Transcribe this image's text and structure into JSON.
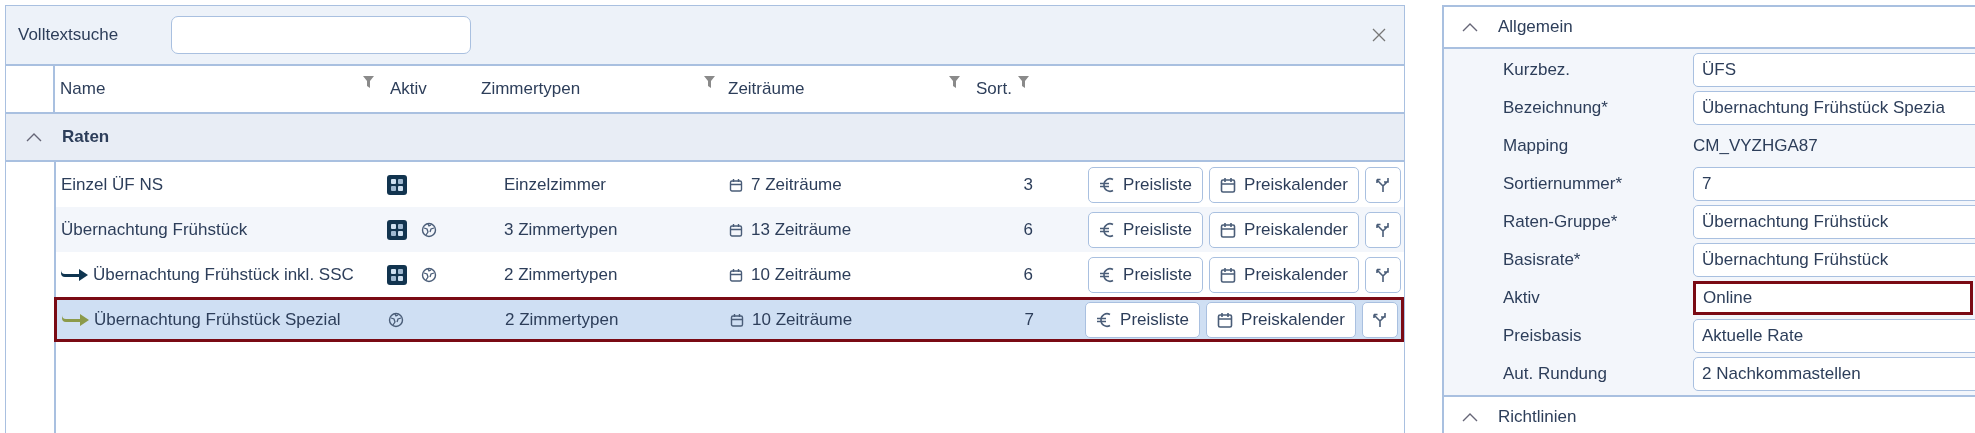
{
  "search": {
    "label": "Volltextsuche"
  },
  "columns": [
    {
      "label": "Name",
      "filterable": true
    },
    {
      "label": "Aktiv",
      "filterable": false
    },
    {
      "label": "Zimmertypen",
      "filterable": true
    },
    {
      "label": "Zeiträume",
      "filterable": true
    },
    {
      "label": "Sort.",
      "filterable": true
    }
  ],
  "group": {
    "label": "Raten",
    "expanded": true
  },
  "rows": [
    {
      "name": "Einzel ÜF NS",
      "online": true,
      "web": false,
      "zimmertypen": "Einzelzimmer",
      "zeitraeume": "7 Zeiträume",
      "sort": "3",
      "selected": false,
      "buttons": [
        "Preisliste",
        "Preiskalender"
      ]
    },
    {
      "name": "Übernachtung Frühstück",
      "online": true,
      "web": true,
      "zimmertypen": "3 Zimmertypen",
      "zeitraeume": "13 Zeiträume",
      "sort": "6",
      "selected": false,
      "buttons": [
        "Preisliste",
        "Preiskalender"
      ]
    },
    {
      "name": "Übernachtung Frühstück inkl. SSC",
      "color": "#0f3550",
      "online": true,
      "web": true,
      "zimmertypen": "2 Zimmertypen",
      "zeitraeume": "10 Zeiträume",
      "sort": "6",
      "selected": false,
      "buttons": [
        "Preisliste",
        "Preiskalender"
      ]
    },
    {
      "name": "Übernachtung Frühstück Spezial",
      "color": "#8c9a4a",
      "online": false,
      "web": true,
      "zimmertypen": "2 Zimmertypen",
      "zeitraeume": "10 Zeiträume",
      "sort": "7",
      "selected": true,
      "buttons": [
        "Preisliste",
        "Preiskalender"
      ]
    }
  ],
  "detail": {
    "sections": [
      {
        "title": "Allgemein",
        "expanded": true,
        "fields": [
          {
            "label": "Kurzbez.",
            "value": "ÜFS",
            "kind": "input"
          },
          {
            "label": "Bezeichnung*",
            "value": "Übernachtung Frühstück Spezia",
            "kind": "input"
          },
          {
            "label": "Mapping",
            "value": "CM_VYZHGA87",
            "kind": "text"
          },
          {
            "label": "Sortiernummer*",
            "value": "7",
            "kind": "input"
          },
          {
            "label": "Raten-Gruppe*",
            "value": "Übernachtung Frühstück",
            "kind": "input"
          },
          {
            "label": "Basisrate*",
            "value": "Übernachtung Frühstück",
            "kind": "input"
          },
          {
            "label": "Aktiv",
            "value": "Online",
            "kind": "input",
            "highlighted": true
          },
          {
            "label": "Preisbasis",
            "value": "Aktuelle Rate",
            "kind": "input"
          },
          {
            "label": "Aut. Rundung",
            "value": "2 Nachkommastellen",
            "kind": "input"
          }
        ]
      },
      {
        "title": "Richtlinien",
        "expanded": true
      }
    ]
  }
}
